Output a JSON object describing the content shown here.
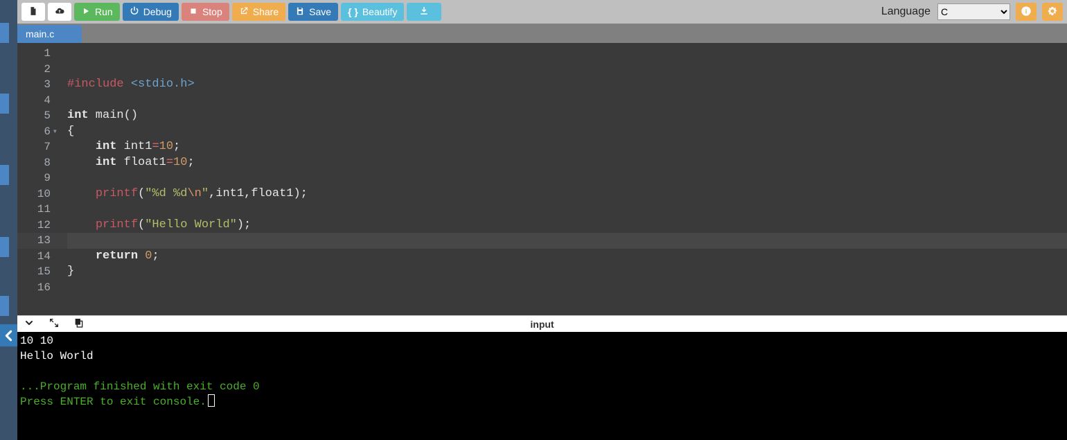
{
  "toolbar": {
    "new_file": "",
    "upload": "",
    "run": "Run",
    "debug": "Debug",
    "stop": "Stop",
    "share": "Share",
    "save": "Save",
    "beautify": "Beautify",
    "download": ""
  },
  "language": {
    "label": "Language",
    "selected": "C",
    "options": [
      "C"
    ]
  },
  "tabs": [
    {
      "label": "main.c",
      "active": true
    }
  ],
  "editor": {
    "active_line": 13,
    "lines": [
      {
        "n": 1,
        "tokens": []
      },
      {
        "n": 2,
        "tokens": []
      },
      {
        "n": 3,
        "tokens": [
          {
            "t": "#include ",
            "c": "kw-pre"
          },
          {
            "t": "<stdio.h>",
            "c": "inc"
          }
        ]
      },
      {
        "n": 4,
        "tokens": []
      },
      {
        "n": 5,
        "tokens": [
          {
            "t": "int",
            "c": "kw-type"
          },
          {
            "t": " main",
            "c": "punct"
          },
          {
            "t": "()",
            "c": "punct"
          }
        ]
      },
      {
        "n": 6,
        "fold": true,
        "tokens": [
          {
            "t": "{",
            "c": "punct"
          }
        ]
      },
      {
        "n": 7,
        "tokens": [
          {
            "t": "    ",
            "c": "punct"
          },
          {
            "t": "int",
            "c": "kw-type"
          },
          {
            "t": " int1",
            "c": "punct"
          },
          {
            "t": "=",
            "c": "op"
          },
          {
            "t": "10",
            "c": "num"
          },
          {
            "t": ";",
            "c": "punct"
          }
        ]
      },
      {
        "n": 8,
        "tokens": [
          {
            "t": "    ",
            "c": "punct"
          },
          {
            "t": "int",
            "c": "kw-type"
          },
          {
            "t": " float1",
            "c": "punct"
          },
          {
            "t": "=",
            "c": "op"
          },
          {
            "t": "10",
            "c": "num"
          },
          {
            "t": ";",
            "c": "punct"
          }
        ]
      },
      {
        "n": 9,
        "tokens": []
      },
      {
        "n": 10,
        "tokens": [
          {
            "t": "    ",
            "c": "punct"
          },
          {
            "t": "printf",
            "c": "kw-pre"
          },
          {
            "t": "(",
            "c": "punct"
          },
          {
            "t": "\"%d %d",
            "c": "str"
          },
          {
            "t": "\\n",
            "c": "esc"
          },
          {
            "t": "\"",
            "c": "str"
          },
          {
            "t": ",int1,float1);",
            "c": "punct"
          }
        ]
      },
      {
        "n": 11,
        "tokens": []
      },
      {
        "n": 12,
        "tokens": [
          {
            "t": "    ",
            "c": "punct"
          },
          {
            "t": "printf",
            "c": "kw-pre"
          },
          {
            "t": "(",
            "c": "punct"
          },
          {
            "t": "\"Hello World\"",
            "c": "str"
          },
          {
            "t": ");",
            "c": "punct"
          }
        ]
      },
      {
        "n": 13,
        "tokens": []
      },
      {
        "n": 14,
        "tokens": [
          {
            "t": "    ",
            "c": "punct"
          },
          {
            "t": "return",
            "c": "kw-ret"
          },
          {
            "t": " ",
            "c": "punct"
          },
          {
            "t": "0",
            "c": "num"
          },
          {
            "t": ";",
            "c": "punct"
          }
        ]
      },
      {
        "n": 15,
        "tokens": [
          {
            "t": "}",
            "c": "punct"
          }
        ]
      },
      {
        "n": 16,
        "tokens": []
      }
    ]
  },
  "console": {
    "label_center": "input",
    "output_plain": "10 10\nHello World\n",
    "output_exit": "\n...Program finished with exit code 0\nPress ENTER to exit console."
  }
}
